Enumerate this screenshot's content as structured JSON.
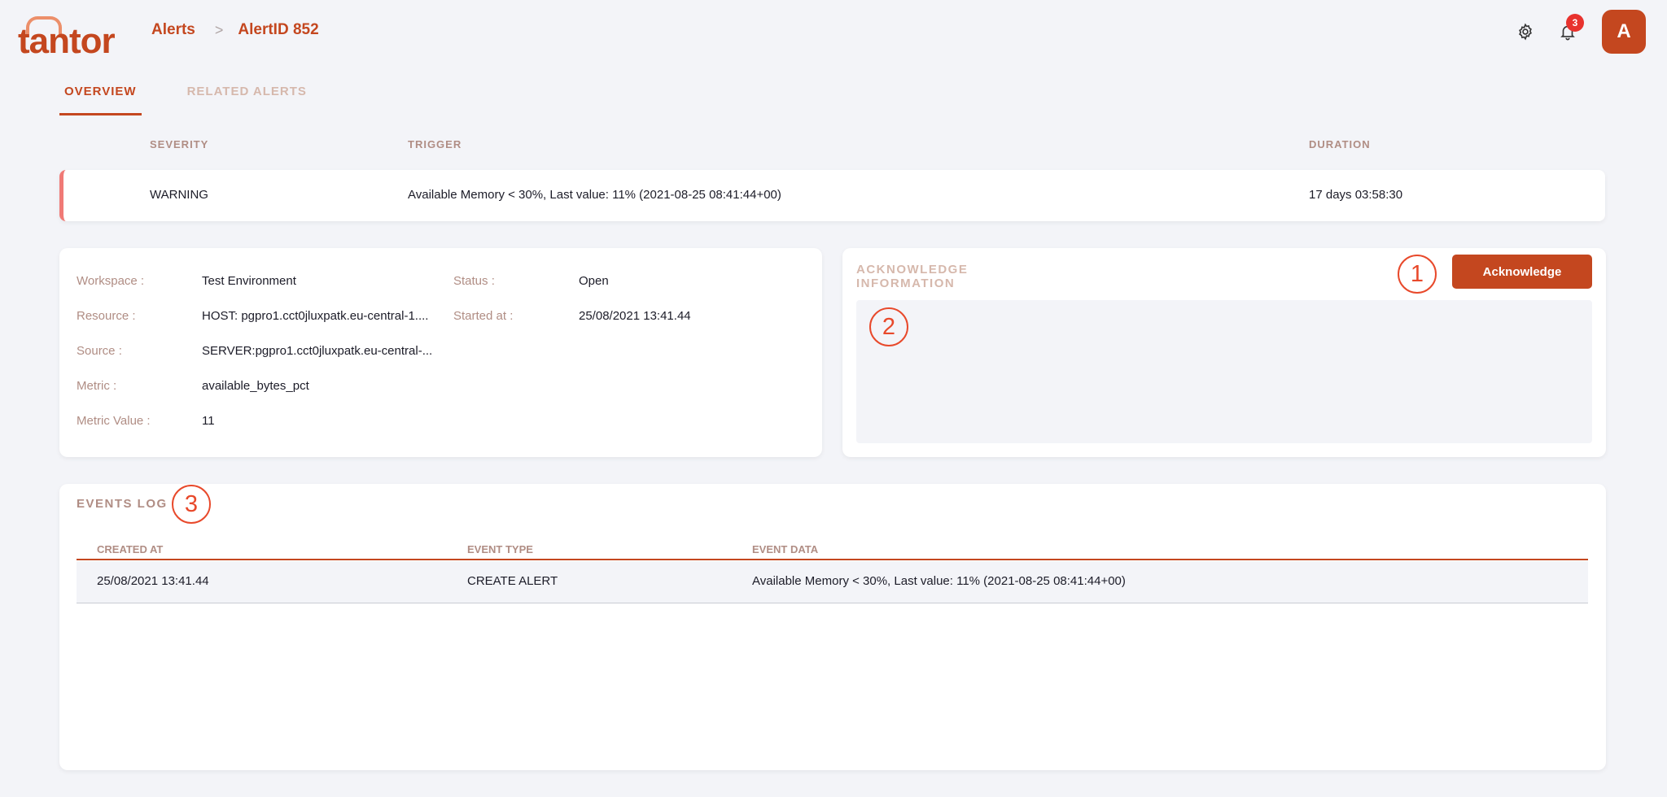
{
  "header": {
    "logo_text": "tantor",
    "breadcrumb": {
      "parent": "Alerts",
      "separator": ">",
      "current": "AlertID 852"
    },
    "notifications_count": "3",
    "avatar_initial": "A",
    "icons": [
      "gear-icon",
      "bell-icon"
    ]
  },
  "tabs": [
    {
      "label": "OVERVIEW",
      "active": true
    },
    {
      "label": "RELATED ALERTS",
      "active": false
    }
  ],
  "severity_table": {
    "headers": {
      "severity": "SEVERITY",
      "trigger": "TRIGGER",
      "duration": "DURATION"
    },
    "row": {
      "severity": "WARNING",
      "trigger": "Available Memory < 30%, Last value: 11% (2021-08-25 08:41:44+00)",
      "duration": "17 days 03:58:30"
    }
  },
  "details": {
    "workspace": {
      "label": "Workspace :",
      "value": "Test Environment"
    },
    "resource": {
      "label": "Resource :",
      "value": "HOST: pgpro1.cct0jluxpatk.eu-central-1...."
    },
    "source": {
      "label": "Source :",
      "value": "SERVER:pgpro1.cct0jluxpatk.eu-central-..."
    },
    "metric": {
      "label": "Metric :",
      "value": "available_bytes_pct"
    },
    "metric_value": {
      "label": "Metric Value :",
      "value": "11"
    },
    "status": {
      "label": "Status :",
      "value": "Open"
    },
    "started_at": {
      "label": "Started at :",
      "value": "25/08/2021 13:41.44"
    }
  },
  "acknowledge": {
    "title": "ACKNOWLEDGE INFORMATION",
    "button_label": "Acknowledge",
    "marker_1": "1",
    "marker_2": "2"
  },
  "events_log": {
    "title": "EVENTS LOG",
    "marker_3": "3",
    "columns": {
      "created_at": "CREATED AT",
      "event_type": "EVENT TYPE",
      "event_data": "EVENT DATA"
    },
    "rows": [
      {
        "created_at": "25/08/2021 13:41.44",
        "event_type": "CREATE ALERT",
        "event_data": "Available Memory < 30%, Last value: 11% (2021-08-25 08:41:44+00)"
      }
    ]
  },
  "colors": {
    "accent": "#c4471f",
    "warning_strip": "#f07a76",
    "badge": "#e8322e",
    "marker": "#e8492b"
  }
}
